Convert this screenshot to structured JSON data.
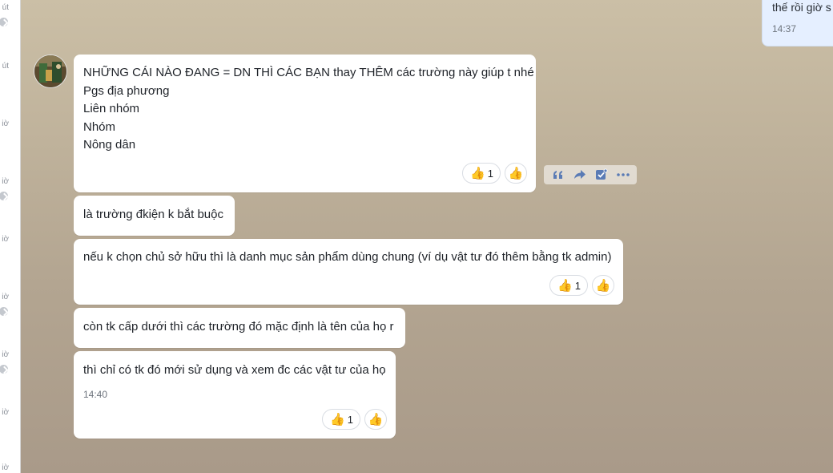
{
  "left_list": [
    {
      "text": "út",
      "has_status": true
    },
    {
      "text": "út",
      "has_status": false
    },
    {
      "text": "iờ",
      "has_status": false
    },
    {
      "text": "iờ",
      "has_status": true
    },
    {
      "text": "iờ",
      "has_status": false
    },
    {
      "text": "iờ",
      "has_status": true
    },
    {
      "text": "iờ",
      "has_status": true
    },
    {
      "text": "iờ",
      "has_status": false
    },
    {
      "text": "iờ",
      "has_status": true
    }
  ],
  "right_message": {
    "text": "thế rồi giờ s",
    "time": "14:37"
  },
  "messages": [
    {
      "lines": [
        "NHỮNG CÁI NÀO ĐANG = DN THÌ CÁC BẠN thay THÊM các trường này giúp t nhé",
        "Pgs địa phương",
        "Liên nhóm",
        "Nhóm",
        "Nông dân"
      ],
      "reaction": {
        "emoji": "👍",
        "count": "1"
      }
    },
    {
      "lines": [
        "là trường đkiện k bắt buộc"
      ]
    },
    {
      "lines": [
        "nếu k chọn chủ sở hữu thì là danh mục sản phẩm dùng chung (ví dụ vật tư đó thêm bằng tk admin)"
      ],
      "reaction": {
        "emoji": "👍",
        "count": "1"
      }
    },
    {
      "lines": [
        "còn tk cấp dưới thì các trường đó mặc định là tên của họ r"
      ]
    },
    {
      "lines": [
        "thì chỉ có tk đó mới sử dụng và xem đc các vật tư của họ"
      ],
      "time": "14:40",
      "reaction": {
        "emoji": "👍",
        "count": "1"
      }
    }
  ],
  "toolbar_icons": [
    "quote-icon",
    "forward-icon",
    "task-icon",
    "more-icon"
  ],
  "colors": {
    "own_bubble": "#e5efff",
    "bubble": "#ffffff",
    "accent": "#5a7bb5"
  }
}
